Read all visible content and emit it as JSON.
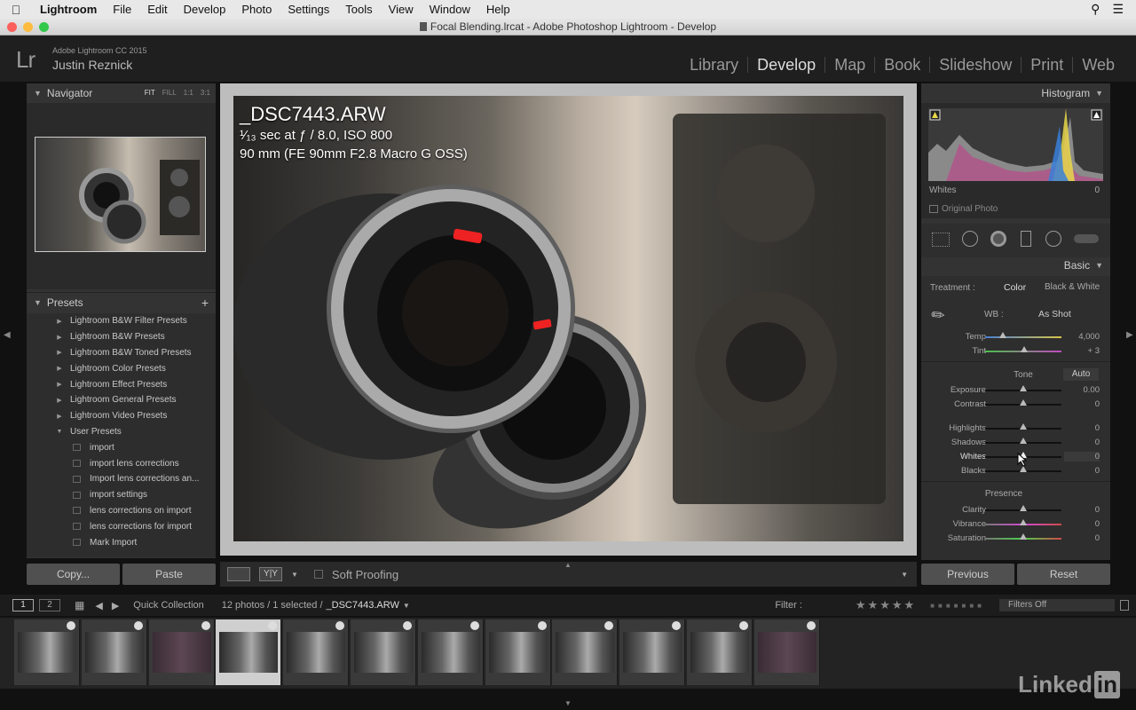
{
  "menubar": {
    "app": "Lightroom",
    "items": [
      "File",
      "Edit",
      "Develop",
      "Photo",
      "Settings",
      "Tools",
      "View",
      "Window",
      "Help"
    ]
  },
  "titlebar": {
    "title": "Focal Blending.lrcat - Adobe Photoshop Lightroom - Develop"
  },
  "identity": {
    "product": "Adobe Lightroom CC 2015",
    "user": "Justin Reznick",
    "logo": "Lr"
  },
  "modules": [
    "Library",
    "Develop",
    "Map",
    "Book",
    "Slideshow",
    "Print",
    "Web"
  ],
  "navigator": {
    "title": "Navigator",
    "modes": [
      "FIT",
      "FILL",
      "1:1",
      "3:1"
    ]
  },
  "presets": {
    "title": "Presets",
    "add": "+",
    "folders": [
      "Lightroom B&W Filter Presets",
      "Lightroom B&W Presets",
      "Lightroom B&W Toned Presets",
      "Lightroom Color Presets",
      "Lightroom Effect Presets",
      "Lightroom General Presets",
      "Lightroom Video Presets",
      "User Presets"
    ],
    "user_items": [
      "import",
      "import lens corrections",
      "Import lens corrections an...",
      "import settings",
      "lens corrections on import",
      "lens corrections for import",
      "Mark Import"
    ]
  },
  "left_buttons": {
    "copy": "Copy...",
    "paste": "Paste"
  },
  "photo_info": {
    "file": "_DSC7443.ARW",
    "exposure": "¹⁄₁₃ sec at ƒ / 8.0, ISO 800",
    "lens": "90 mm (FE 90mm F2.8 Macro G OSS)"
  },
  "toolbar": {
    "soft_proofing": "Soft Proofing",
    "yy": "Y|Y"
  },
  "histogram": {
    "title": "Histogram",
    "readout_label": "Whites",
    "readout_value": "0",
    "original_photo": "Original Photo"
  },
  "basic": {
    "title": "Basic",
    "treatment_label": "Treatment :",
    "treatment_color": "Color",
    "treatment_bw": "Black & White",
    "wb_label": "WB :",
    "wb_value": "As Shot",
    "temp": {
      "label": "Temp",
      "value": "4,000",
      "pos": 0.23
    },
    "tint": {
      "label": "Tint",
      "value": "+ 3",
      "pos": 0.51
    },
    "tone_label": "Tone",
    "auto": "Auto",
    "exposure": {
      "label": "Exposure",
      "value": "0.00",
      "pos": 0.5
    },
    "contrast": {
      "label": "Contrast",
      "value": "0",
      "pos": 0.5
    },
    "highlights": {
      "label": "Highlights",
      "value": "0",
      "pos": 0.5
    },
    "shadows": {
      "label": "Shadows",
      "value": "0",
      "pos": 0.5
    },
    "whites": {
      "label": "Whites",
      "value": "0",
      "pos": 0.5
    },
    "blacks": {
      "label": "Blacks",
      "value": "0",
      "pos": 0.5
    },
    "presence_label": "Presence",
    "clarity": {
      "label": "Clarity",
      "value": "0",
      "pos": 0.5
    },
    "vibrance": {
      "label": "Vibrance",
      "value": "0",
      "pos": 0.5
    },
    "saturation": {
      "label": "Saturation",
      "value": "0",
      "pos": 0.5
    }
  },
  "right_buttons": {
    "previous": "Previous",
    "reset": "Reset"
  },
  "filmstrip": {
    "screen1": "1",
    "screen2": "2",
    "source": "Quick Collection",
    "count": "12 photos / 1 selected /",
    "selected_file": "_DSC7443.ARW",
    "filter_label": "Filter :",
    "filters_off": "Filters Off",
    "thumbs": [
      {
        "dark": false,
        "selected": false
      },
      {
        "dark": false,
        "selected": false
      },
      {
        "dark": true,
        "selected": false
      },
      {
        "dark": false,
        "selected": true
      },
      {
        "dark": false,
        "selected": false
      },
      {
        "dark": false,
        "selected": false
      },
      {
        "dark": false,
        "selected": false
      },
      {
        "dark": false,
        "selected": false
      },
      {
        "dark": false,
        "selected": false
      },
      {
        "dark": false,
        "selected": false
      },
      {
        "dark": false,
        "selected": false
      },
      {
        "dark": true,
        "selected": false
      }
    ]
  },
  "watermark": {
    "text": "Linked",
    "in": "in"
  },
  "colors": {
    "accent": "#d8d8d8",
    "panel": "#2e2e2e",
    "background": "#111111"
  }
}
